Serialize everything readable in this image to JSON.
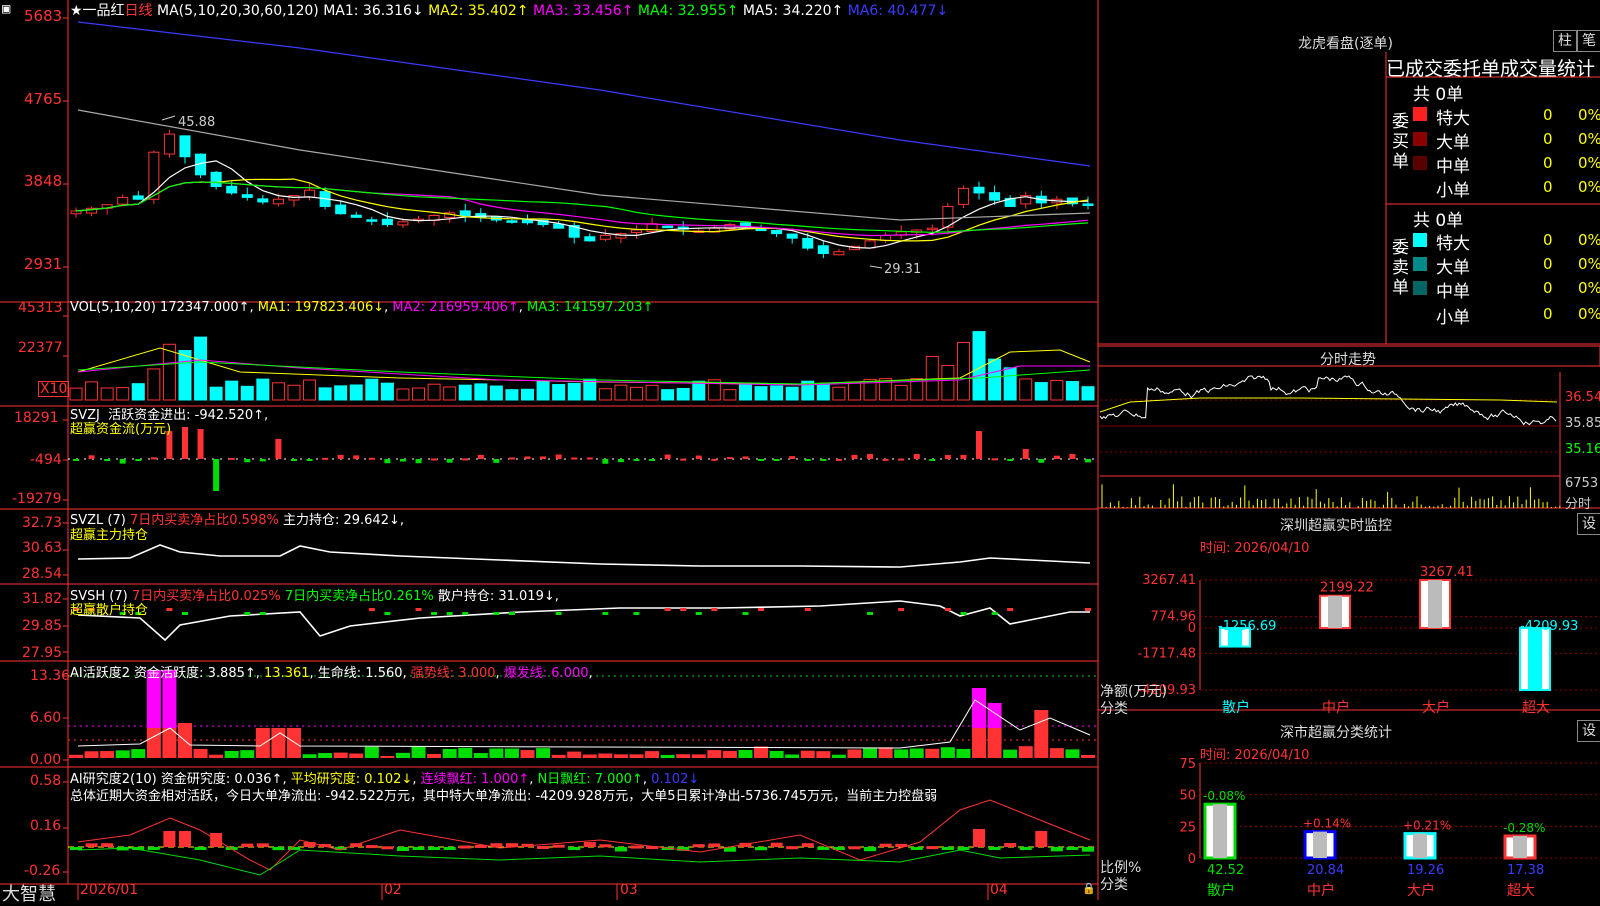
{
  "colors": {
    "up": "#ff3333",
    "down": "#00ffff",
    "bg": "#000000",
    "grid": "#8b0000",
    "axis": "#ff3333",
    "ma1": "#ffffff",
    "ma2": "#ffff00",
    "ma3": "#ff00ff",
    "ma4": "#00ff00",
    "ma5": "#aaaaaa",
    "ma6": "#3b3bff"
  },
  "header": {
    "title": "★一品红",
    "period": "日线",
    "ma_label": "MA(5,10,20,30,60,120)",
    "ma1": "MA1: 36.316↓",
    "ma2": "MA2: 35.402↑",
    "ma3": "MA3: 33.456↑",
    "ma4": "MA4: 32.955↑",
    "ma5": "MA5: 34.220↑",
    "ma6": "MA6: 40.477↓"
  },
  "price_axis": [
    "5683",
    "4765",
    "3848",
    "2931"
  ],
  "annotations": {
    "high": "45.88",
    "low": "29.31"
  },
  "vol": {
    "label": "VOL(5,10,20)",
    "value": "172347.000↑",
    "ma1": "MA1: 197823.406↓",
    "ma2": "MA2: 216959.406↑",
    "ma3": "MA3: 141597.203↑",
    "axis": [
      "45313",
      "22377"
    ],
    "unit": "X10"
  },
  "svzj": {
    "label": "SVZJ",
    "text": "活跃资金进出: -942.520↑,",
    "sub": "超赢资金流(万元)",
    "axis": [
      "18291",
      "-494",
      "-19279"
    ]
  },
  "svzl": {
    "label": "SVZL (7)",
    "p1": "7日内买卖净占比0.598%",
    "p2": "主力持仓: 29.642↓,",
    "sub": "超赢主力持仓",
    "axis": [
      "32.73",
      "30.63",
      "28.54"
    ]
  },
  "svsh": {
    "label": "SVSH (7)",
    "p1": "7日内买卖净占比0.025%",
    "p2": "7日内买卖净占比0.261%",
    "p3": "散户持仓: 31.019↓,",
    "sub": "超赢散户持仓",
    "axis": [
      "31.82",
      "29.85",
      "27.95"
    ]
  },
  "ai1": {
    "label": "AI活跃度2",
    "t1": "资金活跃度: 3.885↑",
    "t2": "13.361",
    "t3": "生命线: 1.560",
    "t4": "强势线: 3.000",
    "t5": "爆发线: 6.000",
    "axis": [
      "13.36",
      "6.60",
      "0.00"
    ]
  },
  "ai2": {
    "label": "AI研究度2(10)",
    "t1": "资金研究度: 0.036↑",
    "t2": "平均研究度: 0.102↓",
    "t3": "连续飘红: 1.000↑",
    "t4": "N日飘红: 7.000↑",
    "t5": "0.102↓",
    "summary": "总体近期大资金相对活跃，今日大单净流出: -942.522万元，其中特大单净流出: -4209.928万元，大单5日累计净出-5736.745万元，当前主力控盘弱",
    "axis": [
      "0.58",
      "0.16",
      "-0.26"
    ]
  },
  "xaxis": [
    "2026/01",
    "02",
    "03",
    "04"
  ],
  "brand": "大智慧",
  "dragon": {
    "title": "龙虎看盘(逐单)",
    "btn1": "柱",
    "btn2": "笔",
    "subtitle": "已成交委托单成交量统计",
    "buy_label": "委买单",
    "sell_label": "委卖单",
    "buy_total": "共 0单",
    "sell_total": "共 0单",
    "rows": [
      {
        "name": "特大",
        "count": "0",
        "pct": "0%"
      },
      {
        "name": "大单",
        "count": "0",
        "pct": "0%"
      },
      {
        "name": "中单",
        "count": "0",
        "pct": "0%"
      },
      {
        "name": "小单",
        "count": "0",
        "pct": "0%"
      }
    ]
  },
  "intraday": {
    "title": "分时走势",
    "axis": [
      "36.54",
      "35.85",
      "35.16"
    ],
    "vol": "6753",
    "unit": "分时"
  },
  "sz_monitor": {
    "title": "深圳超赢实时监控",
    "time": "时间: 2026/04/10",
    "btn": "设",
    "axis": [
      "3267.41",
      "774.96",
      "0",
      "-1717.48",
      "-4209.93"
    ],
    "y_label": "净额(万元)",
    "x_label": "分类",
    "categories": [
      "散户",
      "中户",
      "大户",
      "超大"
    ],
    "values": [
      -1256.69,
      2199.22,
      3267.41,
      -4209.93
    ],
    "value_labels": [
      "-1256.69",
      "2199.22",
      "3267.41",
      "-4209.93"
    ]
  },
  "sz_class": {
    "title": "深市超赢分类统计",
    "time": "时间: 2026/04/10",
    "btn": "设",
    "axis": [
      "75",
      "50",
      "25",
      "0"
    ],
    "y_label": "比例%",
    "x_label": "分类",
    "categories": [
      "散户",
      "中户",
      "大户",
      "超大"
    ],
    "values": [
      42.52,
      20.84,
      19.26,
      17.38
    ],
    "changes": [
      "-0.08%",
      "+0.14%",
      "+0.21%",
      "-0.28%"
    ],
    "value_labels": [
      "42.52",
      "20.84",
      "19.26",
      "17.38"
    ]
  },
  "chart_data": [
    {
      "type": "bar",
      "title": "深圳超赢实时监控",
      "ylabel": "净额(万元)",
      "categories": [
        "散户",
        "中户",
        "大户",
        "超大"
      ],
      "values": [
        -1256.69,
        2199.22,
        3267.41,
        -4209.93
      ],
      "ylim": [
        -4209.93,
        3267.41
      ]
    },
    {
      "type": "bar",
      "title": "深市超赢分类统计",
      "ylabel": "比例%",
      "categories": [
        "散户",
        "中户",
        "大户",
        "超大"
      ],
      "values": [
        42.52,
        20.84,
        19.26,
        17.38
      ],
      "ylim": [
        0,
        75
      ]
    },
    {
      "type": "line",
      "title": "",
      "series": [
        {
          "name": "MA1",
          "values": [
            36.316
          ]
        },
        {
          "name": "MA2",
          "values": [
            35.402
          ]
        },
        {
          "name": "MA3",
          "values": [
            33.456
          ]
        },
        {
          "name": "MA4",
          "values": [
            32.955
          ]
        },
        {
          "name": "MA5",
          "values": [
            34.22
          ]
        },
        {
          "name": "MA6",
          "values": [
            40.477
          ]
        }
      ],
      "x": [
        "2026/01",
        "02",
        "03",
        "04"
      ]
    }
  ]
}
